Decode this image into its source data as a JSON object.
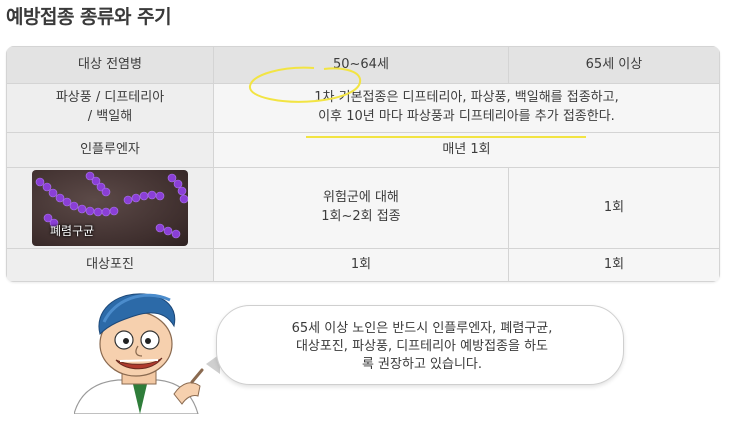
{
  "title": "예방접종 종류와 주기",
  "table": {
    "headers": [
      "대상 전염병",
      "50~64세",
      "65세 이상"
    ],
    "rows": [
      {
        "label_lines": [
          "파상풍 / 디프테리아",
          "/ 백일해"
        ],
        "merged_lines": [
          "1차 기본접종은 디프테리아, 파상풍, 백일해를 접종하고,",
          "이후 10년 마다 파상풍과 디프테리아를 추가 접종한다."
        ]
      },
      {
        "label": "인플루엔자",
        "merged": "매년 1회"
      },
      {
        "image_caption": "폐렴구균",
        "col1_lines": [
          "위험군에 대해",
          "1회~2회 접종"
        ],
        "col2": "1회"
      },
      {
        "label": "대상포진",
        "col1": "1회",
        "col2": "1회"
      }
    ]
  },
  "bubble": {
    "lines": [
      "65세 이상 노인은 반드시 인플루엔자, 폐렴구균,",
      "대상포진, 파상풍, 디프테리아 예방접종을 하도",
      "록 권장하고 있습니다."
    ]
  },
  "colors": {
    "highlight": "#f2e443",
    "bacteria": "#8a3fd6"
  }
}
